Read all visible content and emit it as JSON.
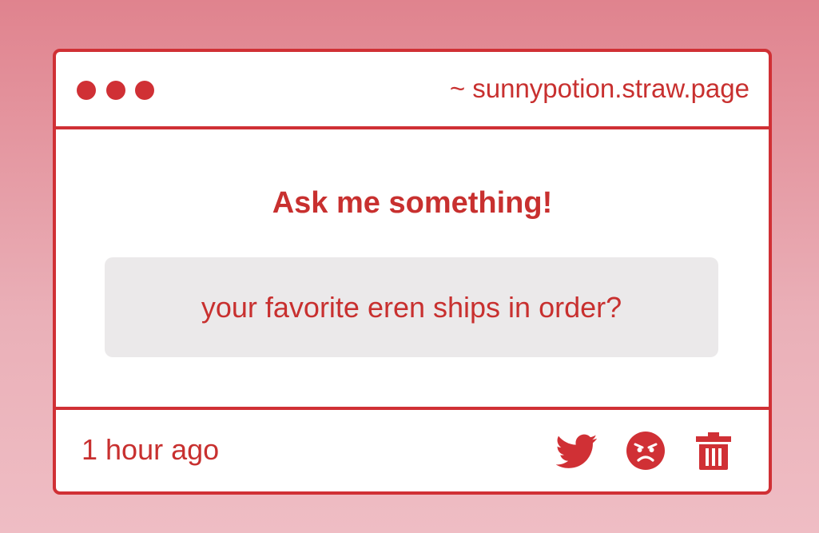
{
  "window": {
    "url": "~ sunnypotion.straw.page"
  },
  "main": {
    "heading": "Ask me something!",
    "question": "your favorite eren ships in order?"
  },
  "footer": {
    "timestamp": "1 hour ago",
    "actions": [
      {
        "icon": "twitter-icon"
      },
      {
        "icon": "angry-face-icon"
      },
      {
        "icon": "trash-icon"
      }
    ]
  },
  "colors": {
    "accent": "#d03035",
    "text": "#c8302f",
    "question_bg": "#ebe9ea",
    "card_bg": "#ffffff"
  }
}
